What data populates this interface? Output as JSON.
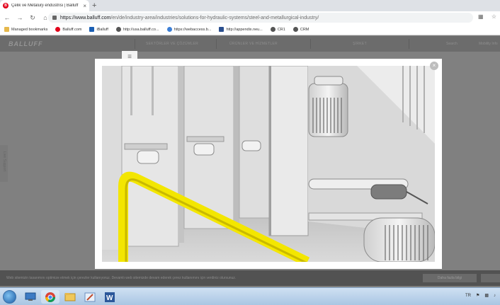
{
  "browser": {
    "tab": {
      "title": "Çelik ve Metalurji endüstrisi | Balluff",
      "favicon": "B"
    },
    "new_tab": "+",
    "address": {
      "host": "https://www.balluff.com",
      "path": "/en/de/industry-area/industries/solutions-for-hydraulic-systems/steel-and-metallurgical-industry/"
    },
    "bookmarks": [
      {
        "label": "Managed bookmarks",
        "icon": "folder-icon",
        "color": "#e6b84c"
      },
      {
        "label": "Balluff.com",
        "icon": "balluff-icon",
        "color": "#e2001a"
      },
      {
        "label": "iBalluff",
        "icon": "iballuff-icon",
        "color": "#1a5fb4"
      },
      {
        "label": "http://usa.balluff.co...",
        "icon": "globe-icon",
        "color": "#555555"
      },
      {
        "label": "https://webaccess.b...",
        "icon": "webaccess-icon",
        "color": "#3c7fd6"
      },
      {
        "label": "http://appendix.neu...",
        "icon": "appendix-icon",
        "color": "#2a4f8f"
      },
      {
        "label": "CR1",
        "icon": "globe-icon",
        "color": "#555555"
      },
      {
        "label": "CRM",
        "icon": "globe-icon",
        "color": "#555555"
      }
    ]
  },
  "site": {
    "logo": "BALLUFF",
    "nav": [
      "SEKTÖRLER VE ÇÖZÜMLER",
      "ÜRÜNLER VE HİZMETLER",
      "ŞİRKET"
    ],
    "search": "Search",
    "account": "Mobility Info",
    "side_tab": "Live Support",
    "menu_glyph": "≡"
  },
  "modal": {
    "close_glyph": "×"
  },
  "cookie": {
    "text": "Web sitemizin tasarımını optimize etmek için çerezler kullanıyoruz. Devamlı web sitemizde devam ederek çerez kullanımını için verdiniz olursunuz.",
    "button": "Daha fazla bilgi"
  },
  "taskbar": {
    "lang": "TR",
    "apps": [
      "explorer-icon",
      "chrome-icon",
      "folder-icon",
      "paint-icon",
      "word-icon"
    ]
  }
}
